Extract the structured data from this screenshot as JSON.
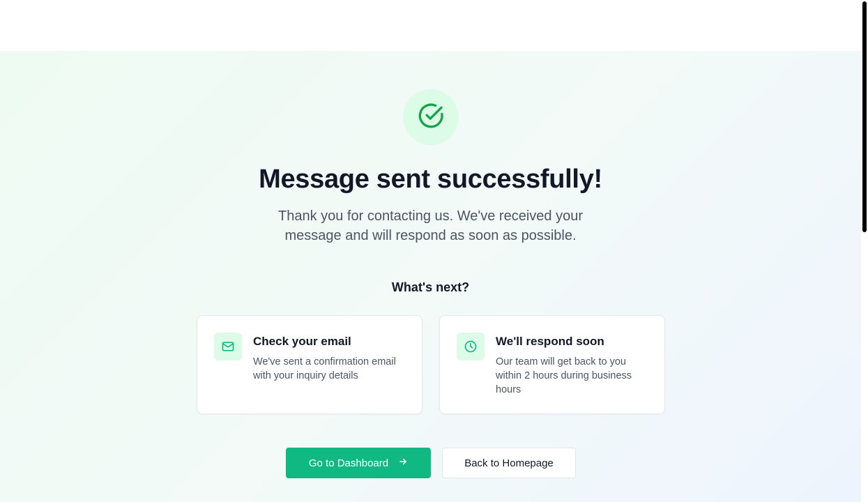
{
  "confirmation": {
    "title": "Message sent successfully!",
    "subtitle": "Thank you for contacting us. We've received your message and will respond as soon as possible.",
    "icon": "check-circle-icon"
  },
  "next_steps": {
    "heading": "What's next?",
    "cards": [
      {
        "icon": "mail-icon",
        "title": "Check your email",
        "text": "We've sent a confirmation email with your inquiry details"
      },
      {
        "icon": "clock-icon",
        "title": "We'll respond soon",
        "text": "Our team will get back to you within 2 hours during business hours"
      }
    ]
  },
  "actions": {
    "primary_label": "Go to Dashboard",
    "primary_icon": "arrow-right-icon",
    "secondary_label": "Back to Homepage"
  },
  "colors": {
    "accent": "#10b981",
    "accent_dark": "#16a34a",
    "accent_light": "#dcfce7",
    "heading": "#111827",
    "body_text": "#4b5563"
  }
}
